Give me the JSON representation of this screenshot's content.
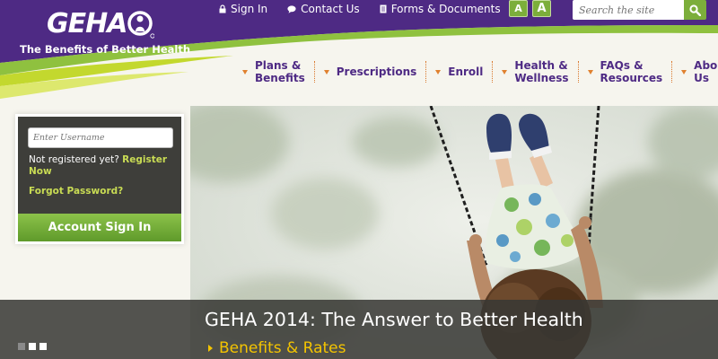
{
  "brand": {
    "logo_text": "GEHA",
    "tagline": "The Benefits of Better Health"
  },
  "top_links": {
    "sign_in": "Sign In",
    "contact_us": "Contact Us",
    "forms_documents": "Forms & Documents"
  },
  "font_size_buttons": [
    "A",
    "A"
  ],
  "search": {
    "placeholder": "Search the site"
  },
  "nav": {
    "items": [
      {
        "label_lines": [
          "Plans &",
          "Benefits"
        ]
      },
      {
        "label_lines": [
          "Prescriptions"
        ]
      },
      {
        "label_lines": [
          "Enroll"
        ]
      },
      {
        "label_lines": [
          "Health &",
          "Wellness"
        ]
      },
      {
        "label_lines": [
          "FAQs &",
          "Resources"
        ]
      },
      {
        "label_lines": [
          "About Us"
        ]
      }
    ]
  },
  "login": {
    "username_placeholder": "Enter Username",
    "not_registered_text": "Not registered yet?",
    "register_link": "Register Now",
    "forgot_password": "Forgot Password?",
    "sign_in_button": "Account Sign In"
  },
  "hero": {
    "title": "GEHA 2014: The Answer to Better Health",
    "link_text": "Benefits & Rates",
    "slides": [
      {
        "active": true
      },
      {
        "active": false
      },
      {
        "active": false
      }
    ]
  },
  "colors": {
    "purple": "#4e2a84",
    "green": "#7cae3b",
    "lime": "#c9dc54",
    "orange": "#e0812f",
    "gold": "#f4c400"
  }
}
